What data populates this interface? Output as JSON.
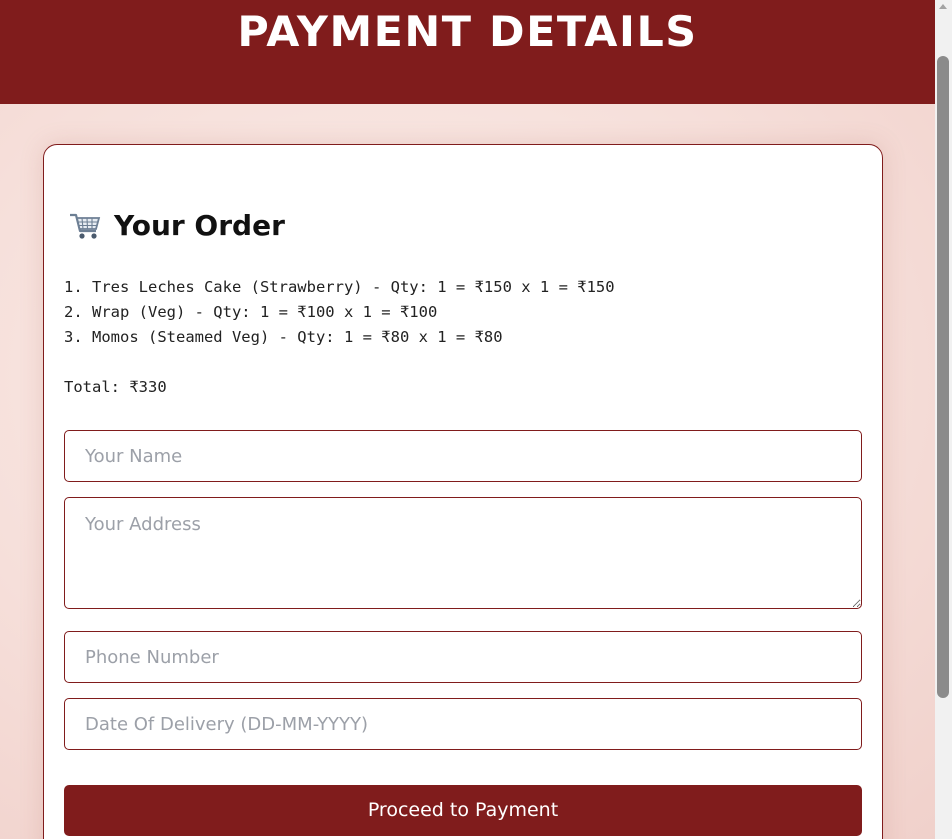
{
  "header": {
    "title": "PAYMENT DETAILS"
  },
  "order": {
    "title": "Your Order",
    "items": [
      "1. Tres Leches Cake (Strawberry) - Qty: 1 = ₹150 x 1 = ₹150",
      "2. Wrap (Veg) - Qty: 1 = ₹100 x 1 = ₹100",
      "3. Momos (Steamed Veg) - Qty: 1 = ₹80 x 1 = ₹80"
    ],
    "total": "Total: ₹330"
  },
  "form": {
    "name_placeholder": "Your Name",
    "address_placeholder": "Your Address",
    "phone_placeholder": "Phone Number",
    "date_placeholder": "Date Of Delivery (DD-MM-YYYY)",
    "submit_label": "Proceed to Payment"
  },
  "icons": {
    "order": "shopping-cart-icon"
  },
  "colors": {
    "accent": "#801c1c",
    "background": "#f6dfda"
  }
}
